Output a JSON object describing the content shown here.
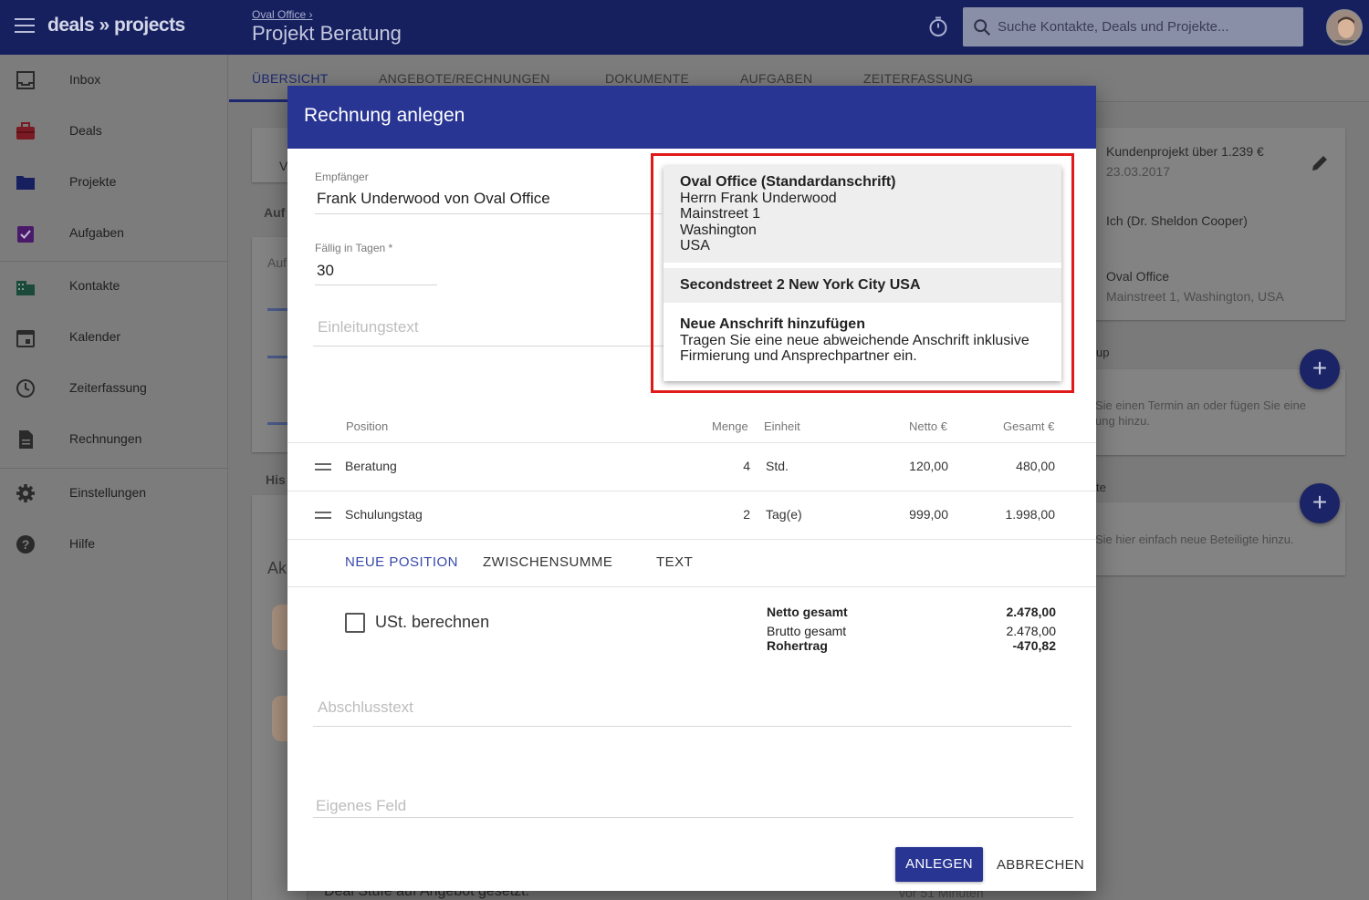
{
  "app": {
    "logo": "deals » projects",
    "breadcrumb": "Oval Office ›",
    "project_title": "Projekt Beratung",
    "search_placeholder": "Suche Kontakte, Deals und Projekte..."
  },
  "sidebar": {
    "items": [
      {
        "label": "Inbox",
        "icon": "inbox-icon"
      },
      {
        "label": "Deals",
        "icon": "briefcase-icon"
      },
      {
        "label": "Projekte",
        "icon": "folder-icon"
      },
      {
        "label": "Aufgaben",
        "icon": "clipboard-check-icon"
      },
      {
        "label": "Kontakte",
        "icon": "building-icon"
      },
      {
        "label": "Kalender",
        "icon": "calendar-icon"
      },
      {
        "label": "Zeiterfassung",
        "icon": "clock-icon"
      },
      {
        "label": "Rechnungen",
        "icon": "document-icon"
      },
      {
        "label": "Einstellungen",
        "icon": "gear-icon"
      },
      {
        "label": "Hilfe",
        "icon": "help-icon"
      }
    ]
  },
  "tabs": [
    "ÜBERSICHT",
    "ANGEBOTE/RECHNUNGEN",
    "DOKUMENTE",
    "AUFGABEN",
    "ZEITERFASSUNG"
  ],
  "background": {
    "left_fragments": [
      "V",
      "Auf",
      "Auf",
      "His",
      "Ak"
    ],
    "deal_title": "Kundenprojekt über 1.239 €",
    "deal_date": "23.03.2017",
    "owner": "Ich (Dr. Sheldon Cooper)",
    "company": "Oval Office",
    "company_address": "Mainstreet 1, Washington, USA",
    "section1_fragment": "up",
    "section1_text1": "Sie einen Termin an oder fügen Sie eine",
    "section1_text2": "ung hinzu.",
    "section2_fragment": "te",
    "section2_text": "Sie hier einfach neue Beteiligte hinzu.",
    "activity_text": "Deal Stufe auf Angebot gesetzt.",
    "activity_time": "vor 51 Minuten"
  },
  "modal": {
    "title": "Rechnung anlegen",
    "recipient_label": "Empfänger",
    "recipient_value": "Frank Underwood von Oval Office",
    "due_label": "Fällig in Tagen *",
    "due_value": "30",
    "intro_placeholder": "Einleitungstext",
    "table": {
      "headers": {
        "position": "Position",
        "menge": "Menge",
        "einheit": "Einheit",
        "netto": "Netto €",
        "gesamt": "Gesamt €"
      },
      "rows": [
        {
          "position": "Beratung",
          "menge": "4",
          "einheit": "Std.",
          "netto": "120,00",
          "gesamt": "480,00"
        },
        {
          "position": "Schulungstag",
          "menge": "2",
          "einheit": "Tag(e)",
          "netto": "999,00",
          "gesamt": "1.998,00"
        }
      ]
    },
    "actions": {
      "new_position": "NEUE POSITION",
      "subtotal": "ZWISCHENSUMME",
      "text": "TEXT"
    },
    "vat_label": "USt. berechnen",
    "totals": [
      {
        "label": "Netto gesamt",
        "value": "2.478,00",
        "bold": true
      },
      {
        "label": "Brutto gesamt",
        "value": "2.478,00",
        "bold": false
      },
      {
        "label": "Rohertrag",
        "value": "-470,82",
        "bold": true
      }
    ],
    "closing_placeholder": "Abschlusstext",
    "custom_field_placeholder": "Eigenes Feld",
    "create_label": "ANLEGEN",
    "cancel_label": "ABBRECHEN"
  },
  "address_dropdown": {
    "options": [
      {
        "lines": [
          "Oval Office (Standardanschrift)",
          "Herrn Frank Underwood",
          "Mainstreet 1",
          "Washington",
          "USA"
        ],
        "selected": true
      },
      {
        "lines": [
          "Secondstreet 2 New York City USA"
        ],
        "selected": true
      },
      {
        "lines": [
          "Neue Anschrift hinzufügen",
          "Tragen Sie eine neue abweichende Anschrift inklusive",
          "Firmierung und Ansprechpartner ein."
        ],
        "selected": false
      }
    ]
  },
  "colors": {
    "primary": "#283593",
    "topbar": "#16205e",
    "highlight": "#e01a1a"
  }
}
